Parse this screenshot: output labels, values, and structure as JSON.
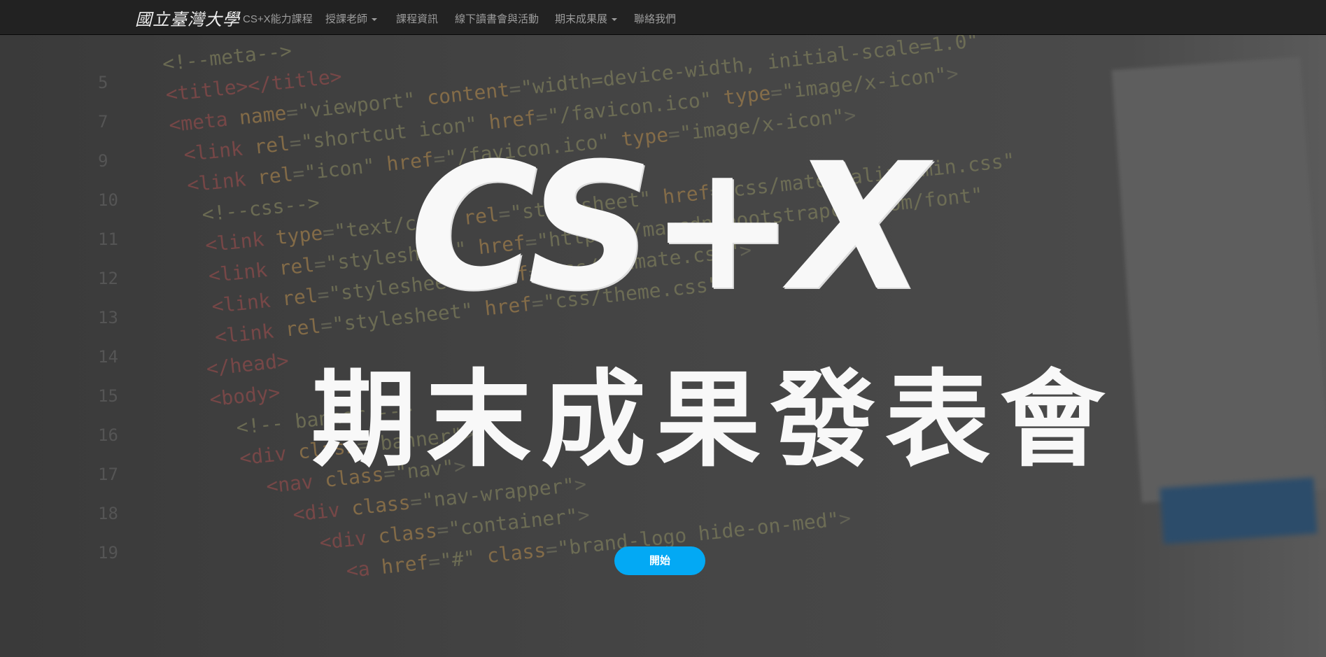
{
  "navbar": {
    "logo": "國立臺灣大學",
    "items": [
      {
        "label": "CS+X能力課程",
        "dropdown": false
      },
      {
        "label": "授課老師",
        "dropdown": true
      },
      {
        "label": "課程資訊",
        "dropdown": false
      },
      {
        "label": "線下讀書會與活動",
        "dropdown": false
      },
      {
        "label": "期末成果展",
        "dropdown": true
      },
      {
        "label": "聯絡我們",
        "dropdown": false
      }
    ]
  },
  "hero": {
    "title": "CS+X",
    "subtitle": "期末成果發表會",
    "start_button": "開始",
    "button_color": "#03a9f4"
  }
}
